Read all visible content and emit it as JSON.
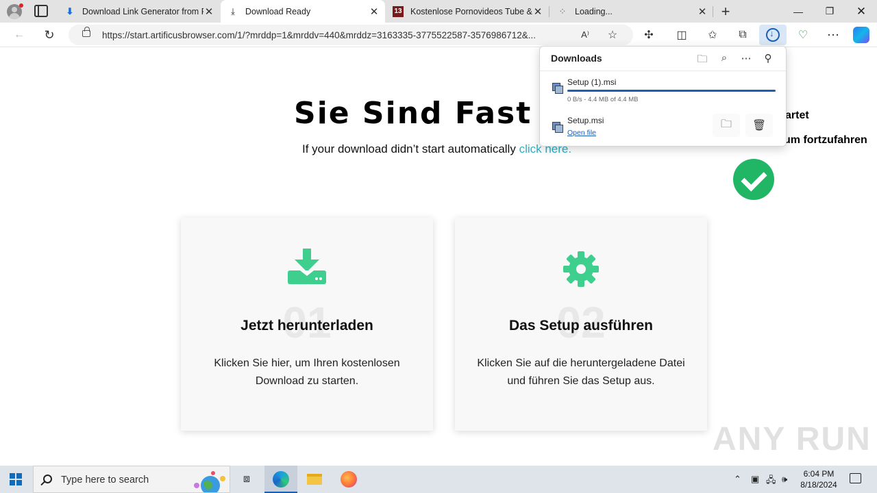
{
  "tabs": [
    {
      "title": "Download Link Generator from F",
      "favicon": "download-arrow-icon"
    },
    {
      "title": "Download Ready",
      "favicon": "download-arrow-icon"
    },
    {
      "title": "Kostenlose Pornovideos Tube & ",
      "favicon": "13-site-icon",
      "favicon_text": "13"
    },
    {
      "title": "Loading...",
      "favicon": "loading-icon"
    }
  ],
  "address": {
    "url": "https://start.artificusbrowser.com/1/?mrddp=1&mrddv=440&mrddz=3163335-3775522587-3576986712&..."
  },
  "page": {
    "title": "Sie Sind Fast D",
    "subtitle": "If your download didn’t start automatically ",
    "subtitle_link": "click here.",
    "right_fragment_1": "artet",
    "right_fragment_2": "um fortzufahren",
    "cards": [
      {
        "num": "01",
        "title": "Jetzt herunterladen",
        "text": "Klicken Sie hier, um Ihren kostenlosen Download zu starten."
      },
      {
        "num": "02",
        "title": "Das Setup ausführen",
        "text": "Klicken Sie auf die heruntergeladene Datei und führen Sie das Setup aus."
      }
    ],
    "accent_color": "#3ecf8e",
    "watermark": "ANY RUN"
  },
  "downloads": {
    "header": "Downloads",
    "items": [
      {
        "name": "Setup (1).msi",
        "status": "0 B/s - 4.4 MB of 4.4 MB",
        "progress": 1.0
      },
      {
        "name": "Setup.msi",
        "action": "Open file"
      }
    ]
  },
  "taskbar": {
    "search_placeholder": "Type here to search",
    "time": "6:04 PM",
    "date": "8/18/2024"
  }
}
